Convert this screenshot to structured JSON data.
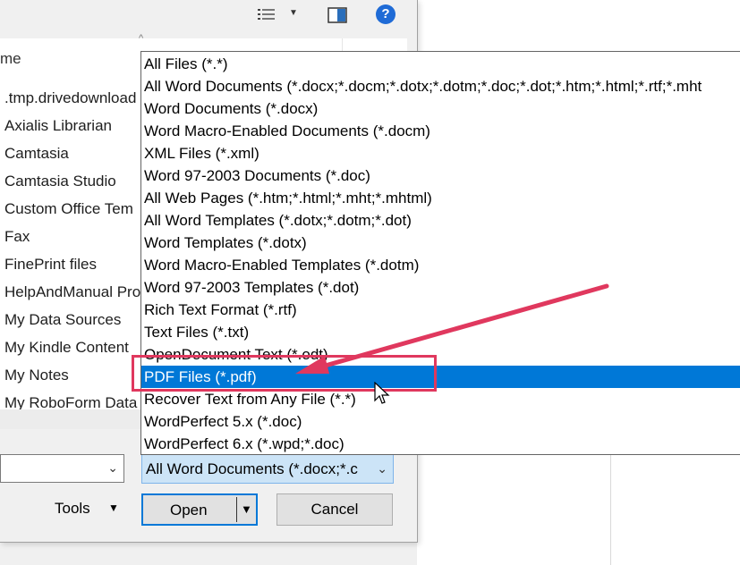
{
  "toolbar": {
    "view_icon": "details-view-icon",
    "pane_icon": "preview-pane-icon",
    "help_icon": "help-icon",
    "help_label": "?"
  },
  "file_list": {
    "column_header": "me",
    "items": [
      ".tmp.drivedownload",
      "Axialis Librarian",
      "Camtasia",
      "Camtasia Studio",
      "Custom Office Tem",
      "Fax",
      "FinePrint files",
      "HelpAndManual Pro",
      "My Data Sources",
      "My Kindle Content",
      "My Notes",
      "My RoboForm Data"
    ]
  },
  "file_type": {
    "selected_label": "All Word Documents (*.docx;*.c",
    "options": [
      "All Files (*.*)",
      "All Word Documents (*.docx;*.docm;*.dotx;*.dotm;*.doc;*.dot;*.htm;*.html;*.rtf;*.mht",
      "Word Documents (*.docx)",
      "Word Macro-Enabled Documents (*.docm)",
      "XML Files (*.xml)",
      "Word 97-2003 Documents (*.doc)",
      "All Web Pages (*.htm;*.html;*.mht;*.mhtml)",
      "All Word Templates (*.dotx;*.dotm;*.dot)",
      "Word Templates (*.dotx)",
      "Word Macro-Enabled Templates (*.dotm)",
      "Word 97-2003 Templates (*.dot)",
      "Rich Text Format (*.rtf)",
      "Text Files (*.txt)",
      "OpenDocument Text (*.odt)",
      "PDF Files (*.pdf)",
      "Recover Text from Any File (*.*)",
      "WordPerfect 5.x (*.doc)",
      "WordPerfect 6.x (*.wpd;*.doc)"
    ],
    "selected_index": 14
  },
  "buttons": {
    "tools": "Tools",
    "open": "Open",
    "cancel": "Cancel"
  },
  "colors": {
    "selection": "#0078d7",
    "annotation": "#e0385e"
  }
}
